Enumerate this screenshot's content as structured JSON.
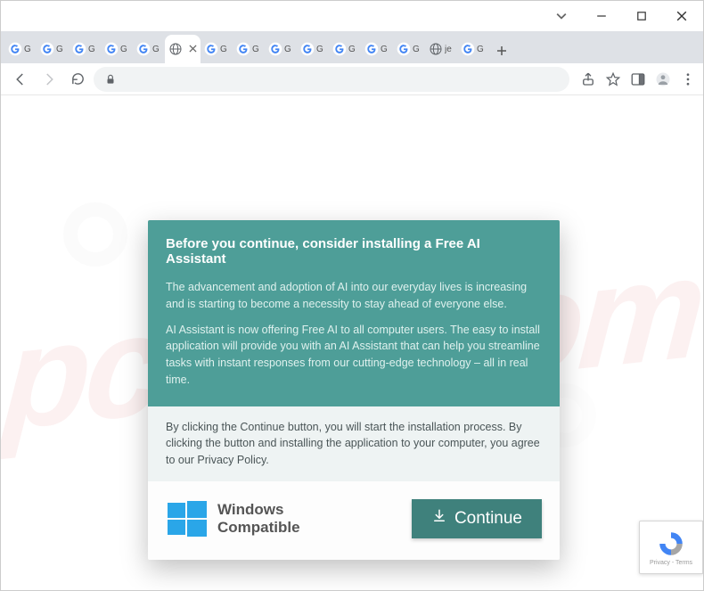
{
  "window": {
    "controls": {
      "min": "minimize",
      "max": "maximize",
      "close": "close"
    }
  },
  "tabs": {
    "items": [
      {
        "label": "G",
        "type": "google"
      },
      {
        "label": "G",
        "type": "google"
      },
      {
        "label": "G",
        "type": "google"
      },
      {
        "label": "G",
        "type": "google"
      },
      {
        "label": "G",
        "type": "google"
      },
      {
        "label": "",
        "type": "globe",
        "active": true
      },
      {
        "label": "G",
        "type": "google"
      },
      {
        "label": "G",
        "type": "google"
      },
      {
        "label": "G",
        "type": "google"
      },
      {
        "label": "G",
        "type": "google"
      },
      {
        "label": "G",
        "type": "google"
      },
      {
        "label": "G",
        "type": "google"
      },
      {
        "label": "G",
        "type": "google"
      },
      {
        "label": "je",
        "type": "globe"
      },
      {
        "label": "G",
        "type": "google"
      }
    ]
  },
  "addressbar": {
    "back": "back",
    "forward": "forward",
    "reload": "reload",
    "secure_icon": "lock-icon"
  },
  "toolbar_right": {
    "share": "share",
    "star": "bookmark",
    "panel": "side-panel",
    "profile": "profile",
    "menu": "menu"
  },
  "dialog": {
    "title": "Before you continue, consider installing a Free AI Assistant",
    "para1": "The advancement and adoption of AI into our everyday lives is increasing and is starting to become a necessity to stay ahead of everyone else.",
    "para2": "AI Assistant is now offering Free AI to all computer users. The easy to install application will provide you with an AI Assistant that can help you streamline tasks with instant responses from our cutting-edge technology – all in real time.",
    "disclaimer": "By clicking the Continue button, you will start the installation process. By clicking the button and installing the application to your computer, you agree to our Privacy Policy.",
    "compat_line1": "Windows",
    "compat_line2": "Compatible",
    "continue_label": "Continue"
  },
  "recaptcha": {
    "footer": "Privacy - Terms"
  },
  "watermark": {
    "text": "pcrisk.com"
  },
  "colors": {
    "teal_dark": "#3f817c",
    "teal": "#4e9e98",
    "gray_bg": "#eef3f3"
  }
}
